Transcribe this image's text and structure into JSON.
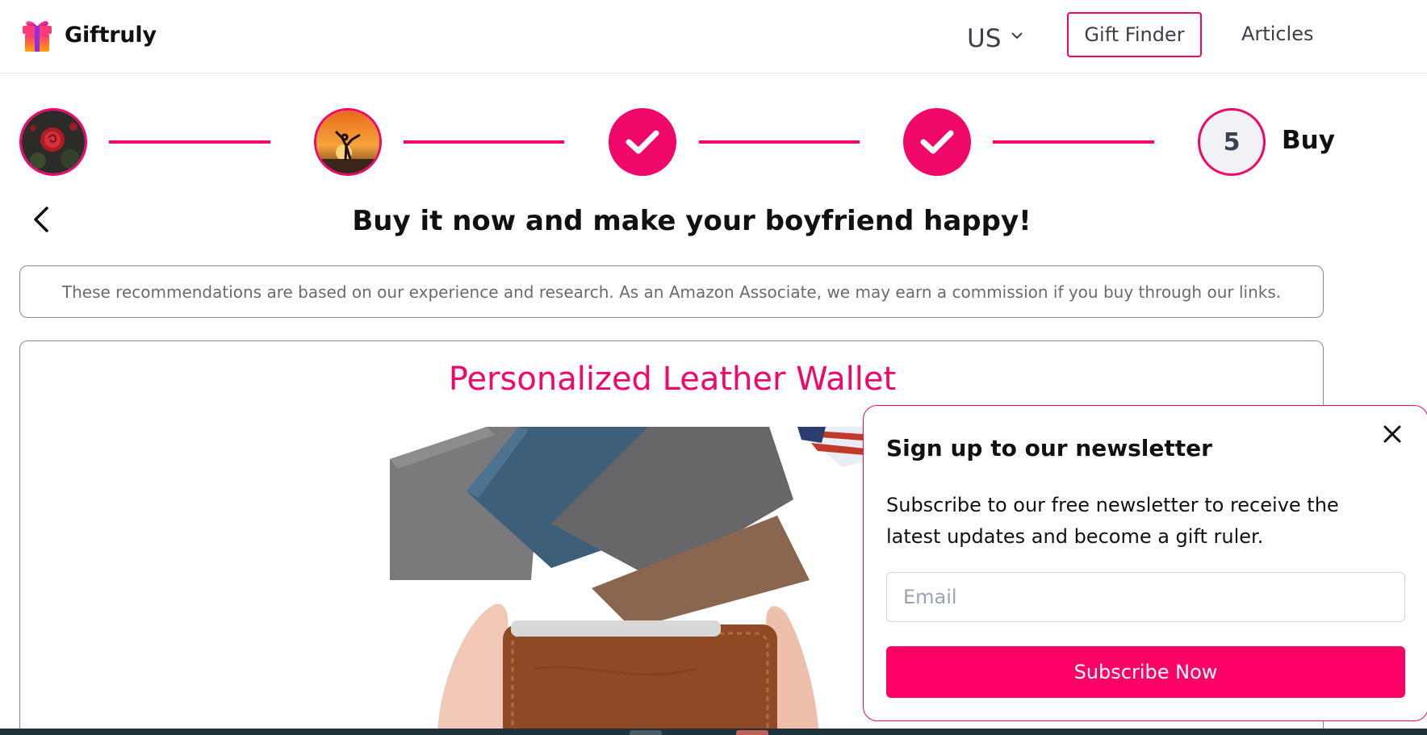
{
  "header": {
    "brand_name": "Giftruly",
    "region": "US",
    "nav": {
      "gift_finder": "Gift Finder",
      "articles": "Articles"
    }
  },
  "stepper": {
    "current_step_number": "5",
    "current_step_label": "Buy",
    "steps": [
      {
        "state": "done",
        "icon": "rose-photo"
      },
      {
        "state": "done",
        "icon": "sunset-silhouette-photo"
      },
      {
        "state": "done",
        "icon": "check-icon"
      },
      {
        "state": "done",
        "icon": "check-icon"
      },
      {
        "state": "current",
        "icon": "number"
      }
    ]
  },
  "main": {
    "title": "Buy it now and make your boyfriend happy!",
    "disclaimer": "These recommendations are based on our experience and research. As an Amazon Associate, we may earn a commission if you buy through our links.",
    "product": {
      "title": "Personalized Leather Wallet",
      "image_icon": "leather-wallet-photo"
    }
  },
  "newsletter": {
    "title": "Sign up to our newsletter",
    "description": "Subscribe to our free newsletter to receive the latest updates and become a gift ruler.",
    "email_placeholder": "Email",
    "email_value": "",
    "submit_label": "Subscribe Now"
  },
  "colors": {
    "accent": "#f0076a",
    "button": "#ff0066",
    "text_muted": "#6b6b6b",
    "nav_text": "#3a3f4b"
  }
}
